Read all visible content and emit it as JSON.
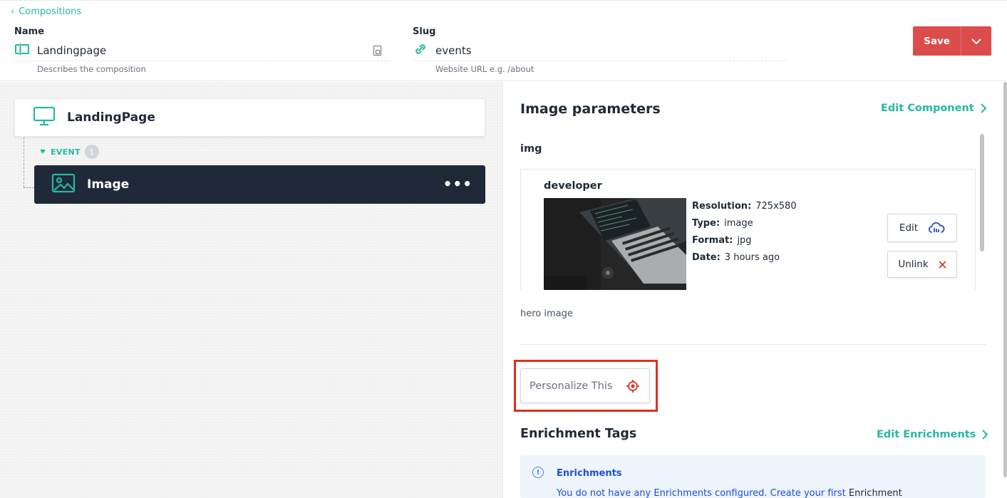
{
  "header": {
    "back_label": "Compositions",
    "name_label": "Name",
    "name_value": "Landingpage",
    "name_help": "Describes the composition",
    "slug_label": "Slug",
    "slug_value": "events",
    "slug_help": "Website URL e.g. /about",
    "save_label": "Save"
  },
  "tree": {
    "root_title": "LandingPage",
    "slot_label": "EVENT",
    "slot_count": "1",
    "child_title": "Image",
    "child_menu": "•••"
  },
  "params": {
    "title": "Image parameters",
    "edit_component_label": "Edit Component",
    "param_name": "img",
    "asset": {
      "name": "developer",
      "resolution_label": "Resolution:",
      "resolution_value": "725x580",
      "type_label": "Type:",
      "type_value": "image",
      "format_label": "Format:",
      "format_value": "jpg",
      "date_label": "Date:",
      "date_value": "3 hours ago",
      "edit_label": "Edit",
      "unlink_label": "Unlink"
    },
    "description": "hero image",
    "personalize_label": "Personalize This"
  },
  "enrichments": {
    "title": "Enrichment Tags",
    "edit_label": "Edit Enrichments",
    "info_title": "Enrichments",
    "info_text_link": "You do not have any Enrichments configured. Create your first",
    "info_text_plain": "Enrichment"
  },
  "colors": {
    "accent": "#25b9a0",
    "save": "#db4c4a",
    "dark_card": "#1f2937",
    "highlight": "#e12f1e",
    "info_bg": "#eef5fd",
    "info_text": "#1d4ed8"
  },
  "icons": [
    "chevron-left-icon",
    "composition-icon",
    "document-icon",
    "link-icon",
    "chevron-down-icon",
    "monitor-icon",
    "triangle-down-icon",
    "image-icon",
    "more-icon",
    "chevron-right-icon",
    "cloud-icon",
    "close-icon",
    "target-icon",
    "info-icon"
  ]
}
